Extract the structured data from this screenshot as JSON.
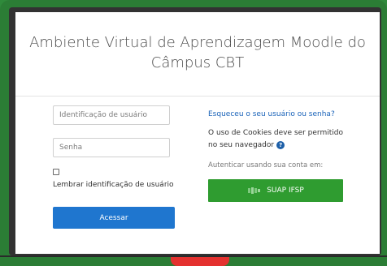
{
  "page": {
    "title_line1": "Ambiente Virtual de Aprendizagem Moodle do",
    "title_line2": "Câmpus CBT"
  },
  "login": {
    "username_placeholder": "Identificação de usuário",
    "password_placeholder": "Senha",
    "remember_label": "Lembrar identificação de usuário",
    "remember_checked": false,
    "submit_label": "Acessar"
  },
  "help": {
    "forgot_link": "Esqueceu o seu usuário ou senha?",
    "cookies_notice": "O uso de Cookies deve ser permitido no seu navegador",
    "help_icon": "question-mark-icon",
    "auth_label": "Autenticar usando sua conta em:",
    "suap_button": "SUAP IFSP"
  },
  "colors": {
    "frame_green": "#2b7d35",
    "login_button": "#1f76cf",
    "suap_button": "#2f9c30",
    "link_blue": "#1a63b9",
    "notch_red": "#e4312f"
  }
}
